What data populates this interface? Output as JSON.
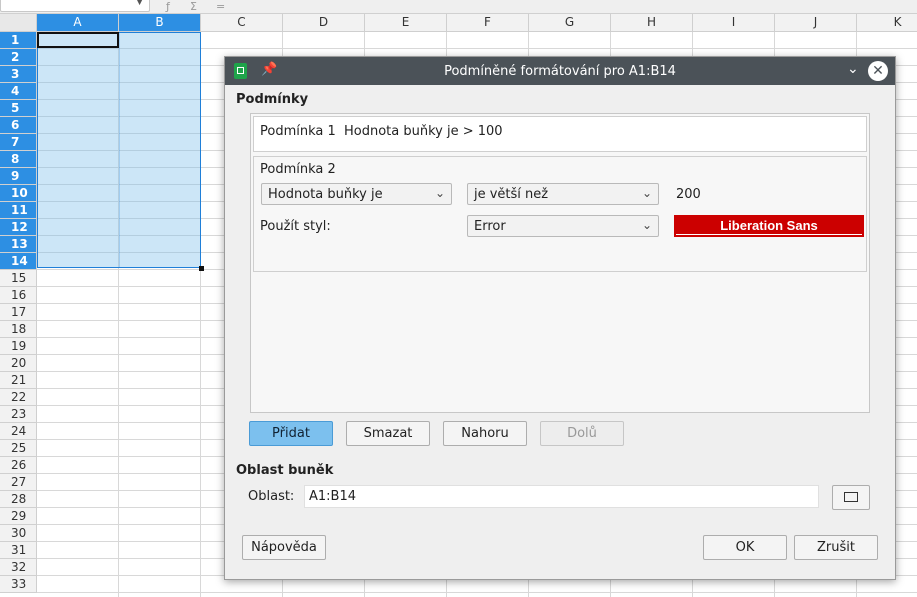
{
  "sheet": {
    "columns": [
      "A",
      "B",
      "C",
      "D",
      "E",
      "F",
      "G",
      "H",
      "I",
      "J",
      "K"
    ],
    "rows": [
      "1",
      "2",
      "3",
      "4",
      "5",
      "6",
      "7",
      "8",
      "9",
      "10",
      "11",
      "12",
      "13",
      "14",
      "15",
      "16",
      "17",
      "18",
      "19",
      "20",
      "21",
      "22",
      "23",
      "24",
      "25",
      "26",
      "27",
      "28",
      "29",
      "30",
      "31",
      "32",
      "33"
    ],
    "selected_columns": [
      "A",
      "B"
    ],
    "selected_rows_count": 14,
    "selection_color": "#2d8fe3"
  },
  "dialog": {
    "title": "Podmíněné formátování pro A1:B14",
    "conditions_section": "Podmínky",
    "condition1": {
      "label": "Podmínka 1",
      "summary": "Hodnota buňky je > 100"
    },
    "condition2": {
      "label": "Podmínka 2",
      "type_value": "Hodnota buňky je",
      "operator_value": "je větší než",
      "operand": "200",
      "style_label": "Použít styl:",
      "style_value": "Error",
      "preview_text": "Liberation Sans",
      "preview_color": "#cc0000"
    },
    "buttons": {
      "add": "Přidat",
      "delete": "Smazat",
      "up": "Nahoru",
      "down": "Dolů",
      "help": "Nápověda",
      "ok": "OK",
      "cancel": "Zrušit"
    },
    "range_section": "Oblast buněk",
    "range_label": "Oblast:",
    "range_value": "A1:B14"
  }
}
